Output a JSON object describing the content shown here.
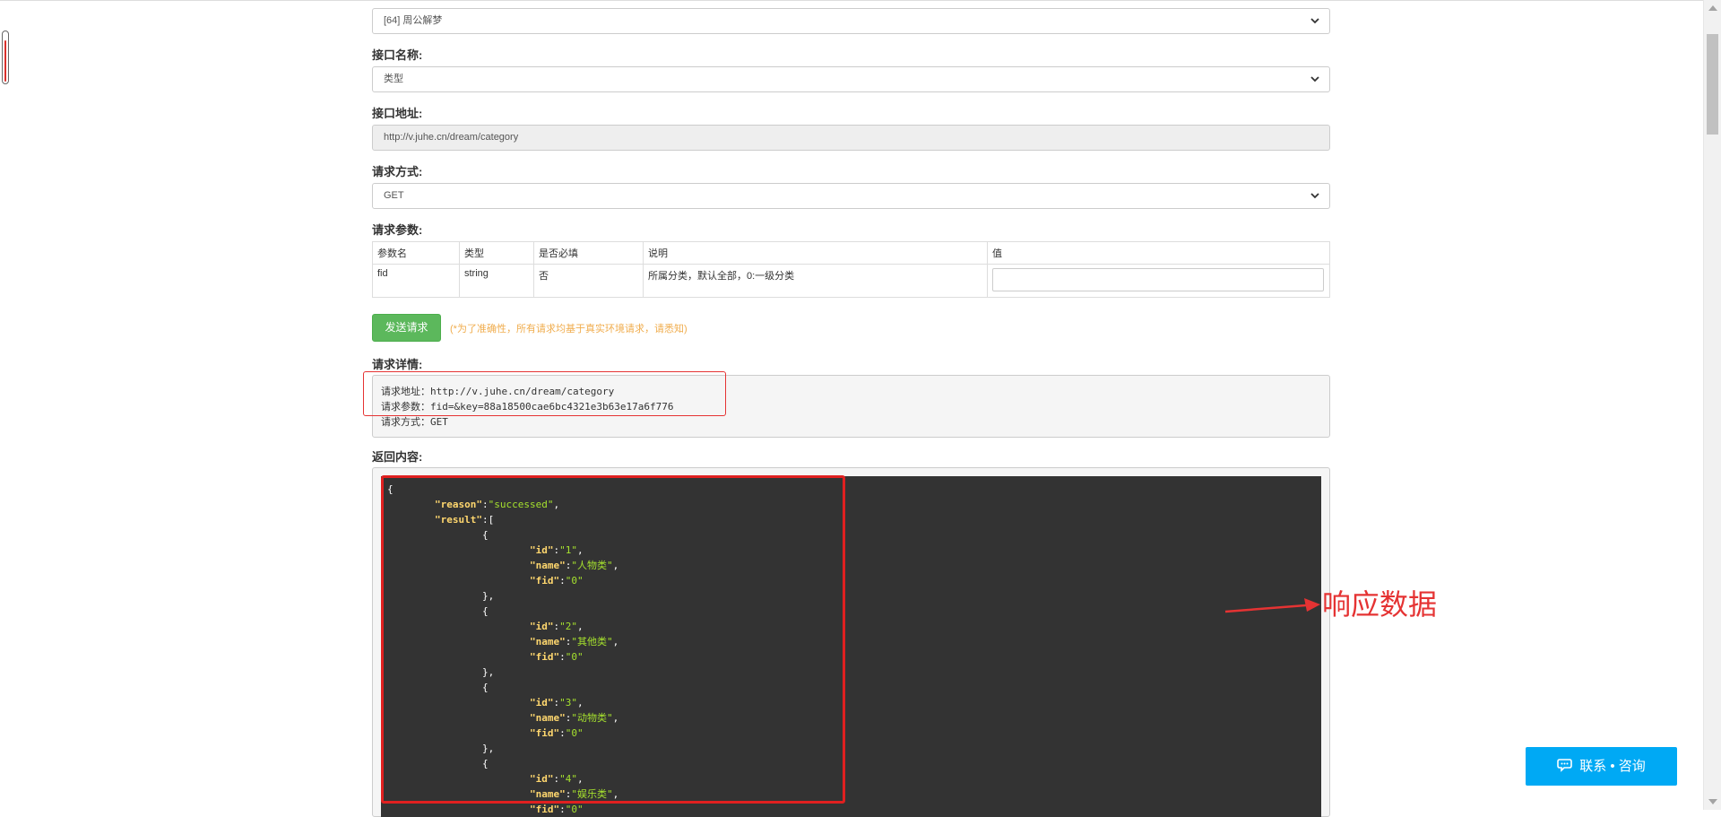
{
  "form": {
    "api_select_value": "[64] 周公解梦",
    "interface_name_label": "接口名称:",
    "interface_name_value": "类型",
    "interface_url_label": "接口地址:",
    "interface_url_value": "http://v.juhe.cn/dream/category",
    "method_label": "请求方式:",
    "method_value": "GET",
    "params_label": "请求参数:",
    "params_table": {
      "headers": [
        "参数名",
        "类型",
        "是否必填",
        "说明",
        "值"
      ],
      "rows": [
        {
          "name": "fid",
          "type": "string",
          "required": "否",
          "desc": "所属分类，默认全部，0:一级分类",
          "value": ""
        }
      ]
    },
    "send_button": "发送请求",
    "notice": "(*为了准确性，所有请求均基于真实环境请求，请悉知)"
  },
  "request_detail": {
    "label": "请求详情:",
    "line1": "请求地址：http://v.juhe.cn/dream/category",
    "line2": "请求参数：fid=&key=88a18500cae6bc4321e3b63e17a6f776",
    "line3": "请求方式：GET"
  },
  "response": {
    "label": "返回内容:",
    "annotation": "响应数据",
    "json": {
      "open": "{",
      "reason_key": "\"reason\"",
      "reason_val": "\"successed\"",
      "result_key": "\"result\"",
      "items": [
        {
          "id": "\"1\"",
          "name": "\"人物类\"",
          "fid": "\"0\""
        },
        {
          "id": "\"2\"",
          "name": "\"其他类\"",
          "fid": "\"0\""
        },
        {
          "id": "\"3\"",
          "name": "\"动物类\"",
          "fid": "\"0\""
        },
        {
          "id": "\"4\"",
          "name": "\"娱乐类\"",
          "fid": "\"0\""
        }
      ],
      "id_key": "\"id\"",
      "name_key": "\"name\"",
      "fid_key": "\"fid\""
    }
  },
  "contact_button": "联系 • 咨询",
  "colors": {
    "send_button": "#5cb85c",
    "notice": "#f0ad4e",
    "annotation_red": "#e53333",
    "contact_button": "#00a9f4",
    "code_bg": "#333333",
    "json_key": "#ffd76e",
    "json_string": "#a6e22e"
  },
  "icons": [
    "chevron-down-icon",
    "chat-icon",
    "thermometer-icon",
    "arrow-right-icon"
  ]
}
